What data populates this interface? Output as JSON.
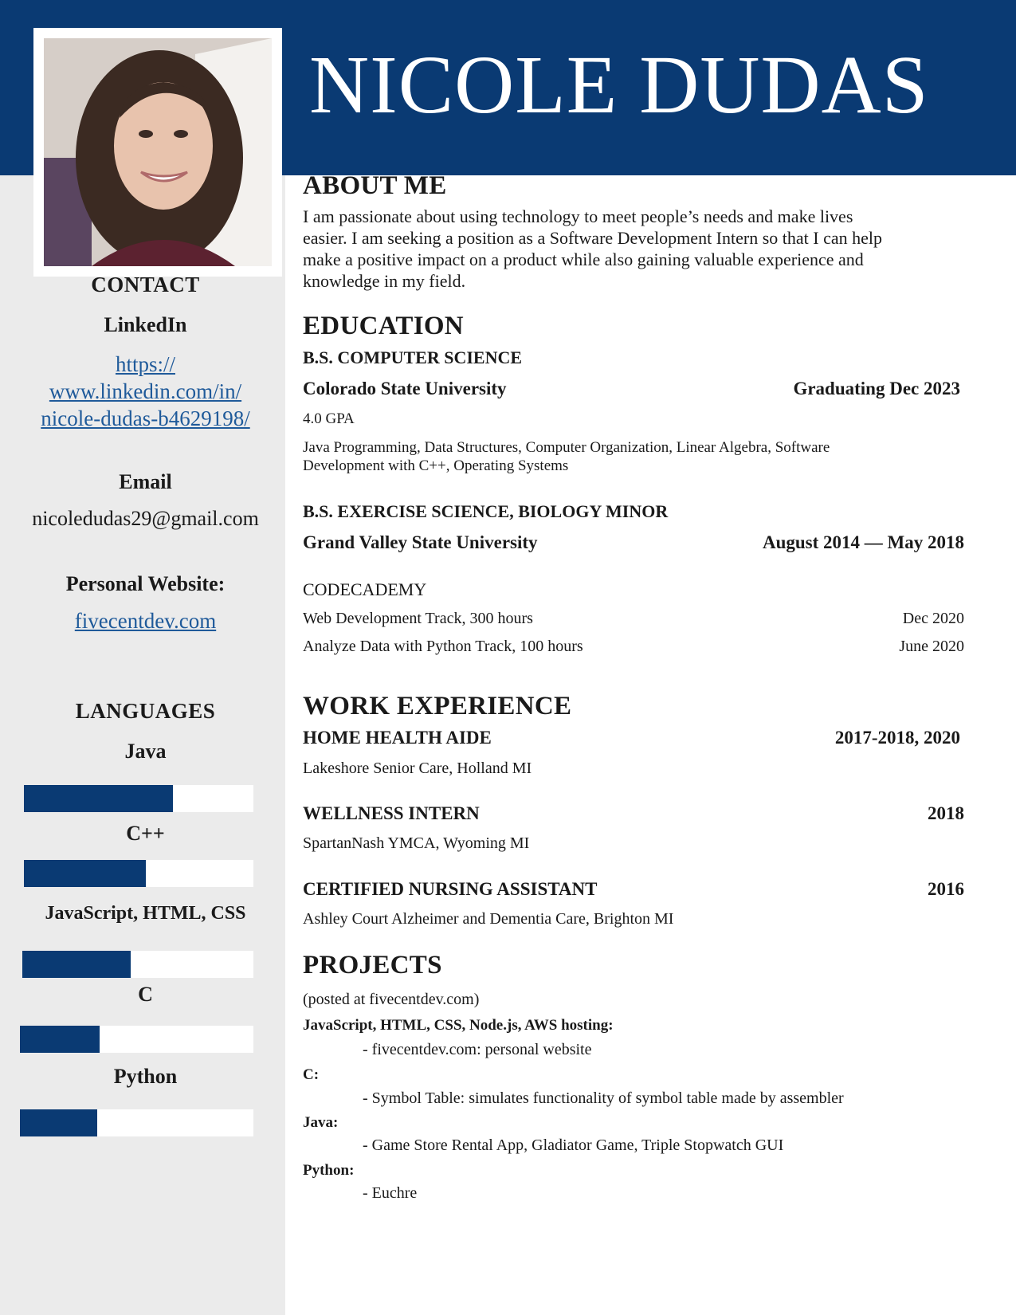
{
  "header": {
    "name": "NICOLE DUDAS"
  },
  "sidebar": {
    "contact_heading": "CONTACT",
    "linkedin_label": "LinkedIn",
    "linkedin_lines": [
      "https://",
      "www.linkedin.com/in/",
      "nicole-dudas-b4629198/"
    ],
    "email_label": "Email",
    "email": "nicoledudas29@gmail.com",
    "website_label": "Personal Website:",
    "website": "fivecentdev.com",
    "languages_heading": "LANGUAGES",
    "languages": [
      {
        "name": "Java",
        "level": 0.65
      },
      {
        "name": "C++",
        "level": 0.53
      },
      {
        "name": "JavaScript, HTML, CSS",
        "level": 0.47
      },
      {
        "name": "C",
        "level": 0.34
      },
      {
        "name": "Python",
        "level": 0.33
      }
    ],
    "accent_color": "#0a3a73"
  },
  "about": {
    "heading": "ABOUT ME",
    "lines": [
      "I am passionate about using technology to meet people’s needs and make lives",
      "easier. I am seeking a position as a Software Development Intern so that I can help",
      "make a positive impact on a product while also gaining valuable experience and",
      "knowledge in my field."
    ]
  },
  "education": {
    "heading": "EDUCATION",
    "degree1": {
      "title": "B.S. COMPUTER SCIENCE",
      "school": "Colorado State University",
      "date": "Graduating Dec 2023",
      "gpa": "4.0 GPA",
      "courses_lines": [
        "Java Programming, Data Structures, Computer Organization, Linear Algebra, Software",
        "Development with C++, Operating Systems"
      ]
    },
    "degree2": {
      "title": "B.S. EXERCISE SCIENCE, BIOLOGY MINOR",
      "school": "Grand Valley State University",
      "date": "August 2014 — May 2018"
    },
    "codecademy": {
      "title": "CODECADEMY",
      "items": [
        {
          "name": "Web Development Track, 300 hours",
          "date": "Dec 2020"
        },
        {
          "name": "Analyze Data with Python Track, 100 hours",
          "date": "June 2020"
        }
      ]
    }
  },
  "work": {
    "heading": "WORK EXPERIENCE",
    "jobs": [
      {
        "title": "HOME HEALTH AIDE",
        "date": "2017-2018, 2020",
        "place": "Lakeshore Senior Care, Holland MI"
      },
      {
        "title": "WELLNESS INTERN",
        "date": "2018",
        "place": "SpartanNash YMCA, Wyoming MI"
      },
      {
        "title": "CERTIFIED NURSING ASSISTANT",
        "date": "2016",
        "place": "Ashley Court Alzheimer and Dementia Care, Brighton MI"
      }
    ]
  },
  "projects": {
    "heading": "PROJECTS",
    "note": "(posted at fivecentdev.com)",
    "groups": [
      {
        "label": "JavaScript, HTML, CSS, Node.js, AWS hosting:",
        "item": "- fivecentdev.com: personal website"
      },
      {
        "label": "C:",
        "item": "- Symbol Table: simulates functionality of symbol table made by assembler"
      },
      {
        "label": "Java:",
        "item": "- Game Store Rental App, Gladiator Game, Triple Stopwatch GUI"
      },
      {
        "label": "Python:",
        "item": "- Euchre"
      }
    ]
  }
}
